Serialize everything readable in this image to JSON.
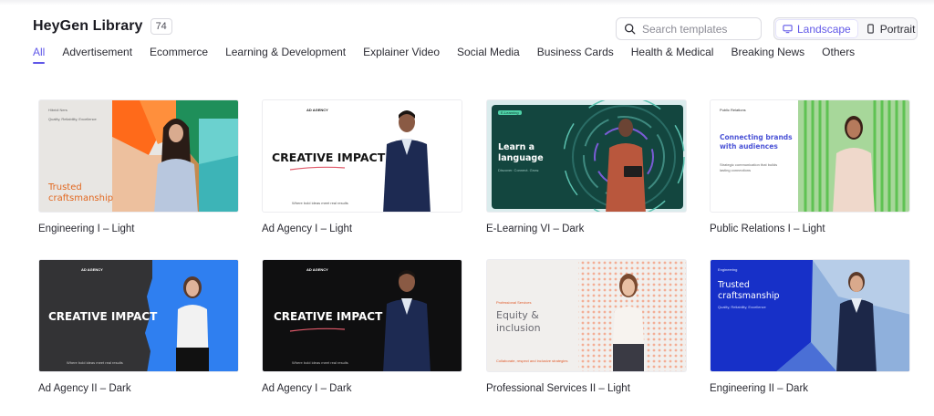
{
  "header": {
    "title": "HeyGen Library",
    "count": "74"
  },
  "search": {
    "placeholder": "Search templates"
  },
  "orientation": {
    "landscape_label": "Landscape",
    "portrait_label": "Portrait"
  },
  "tabs": [
    {
      "label": "All"
    },
    {
      "label": "Advertisement"
    },
    {
      "label": "Ecommerce"
    },
    {
      "label": "Learning & Development"
    },
    {
      "label": "Explainer Video"
    },
    {
      "label": "Social Media"
    },
    {
      "label": "Business Cards"
    },
    {
      "label": "Health & Medical"
    },
    {
      "label": "Breaking News"
    },
    {
      "label": "Others"
    }
  ],
  "templates": [
    {
      "label": "Engineering I – Light",
      "thumb": {
        "kicker": "Hibridi Ners",
        "sub": "Quality, Reliability, Excellence",
        "headline": "Trusted craftsmanship"
      }
    },
    {
      "label": "Ad Agency I – Light",
      "thumb": {
        "kicker": "AD AGENCY",
        "headline": "CREATIVE IMPACT",
        "sub": "Where bold ideas meet real results"
      }
    },
    {
      "label": "E-Learning VI – Dark",
      "thumb": {
        "kicker": "E-Learning",
        "headline": "Learn a language",
        "sub": "Discover. Connect. Grow."
      }
    },
    {
      "label": "Public Relations I – Light",
      "thumb": {
        "kicker": "Public Relations",
        "headline": "Connecting brands with audiences",
        "sub": "Strategic communication that builds lasting connections"
      }
    },
    {
      "label": "Ad Agency II – Dark",
      "thumb": {
        "kicker": "AD AGENCY",
        "headline": "CREATIVE IMPACT",
        "sub": "Where bold ideas meet real results"
      }
    },
    {
      "label": "Ad Agency I – Dark",
      "thumb": {
        "kicker": "AD AGENCY",
        "headline": "CREATIVE IMPACT",
        "sub": "Where bold ideas meet real results"
      }
    },
    {
      "label": "Professional Services II – Light",
      "thumb": {
        "kicker": "Professional Services",
        "headline": "Equity & inclusion",
        "sub": "Collaborate, respect and inclusive strategies"
      }
    },
    {
      "label": "Engineering II – Dark",
      "thumb": {
        "kicker": "Engineering",
        "headline": "Trusted craftsmanship",
        "sub": "Quality, Reliability, Excellence"
      }
    }
  ],
  "colors": {
    "accent": "#6158e8"
  }
}
